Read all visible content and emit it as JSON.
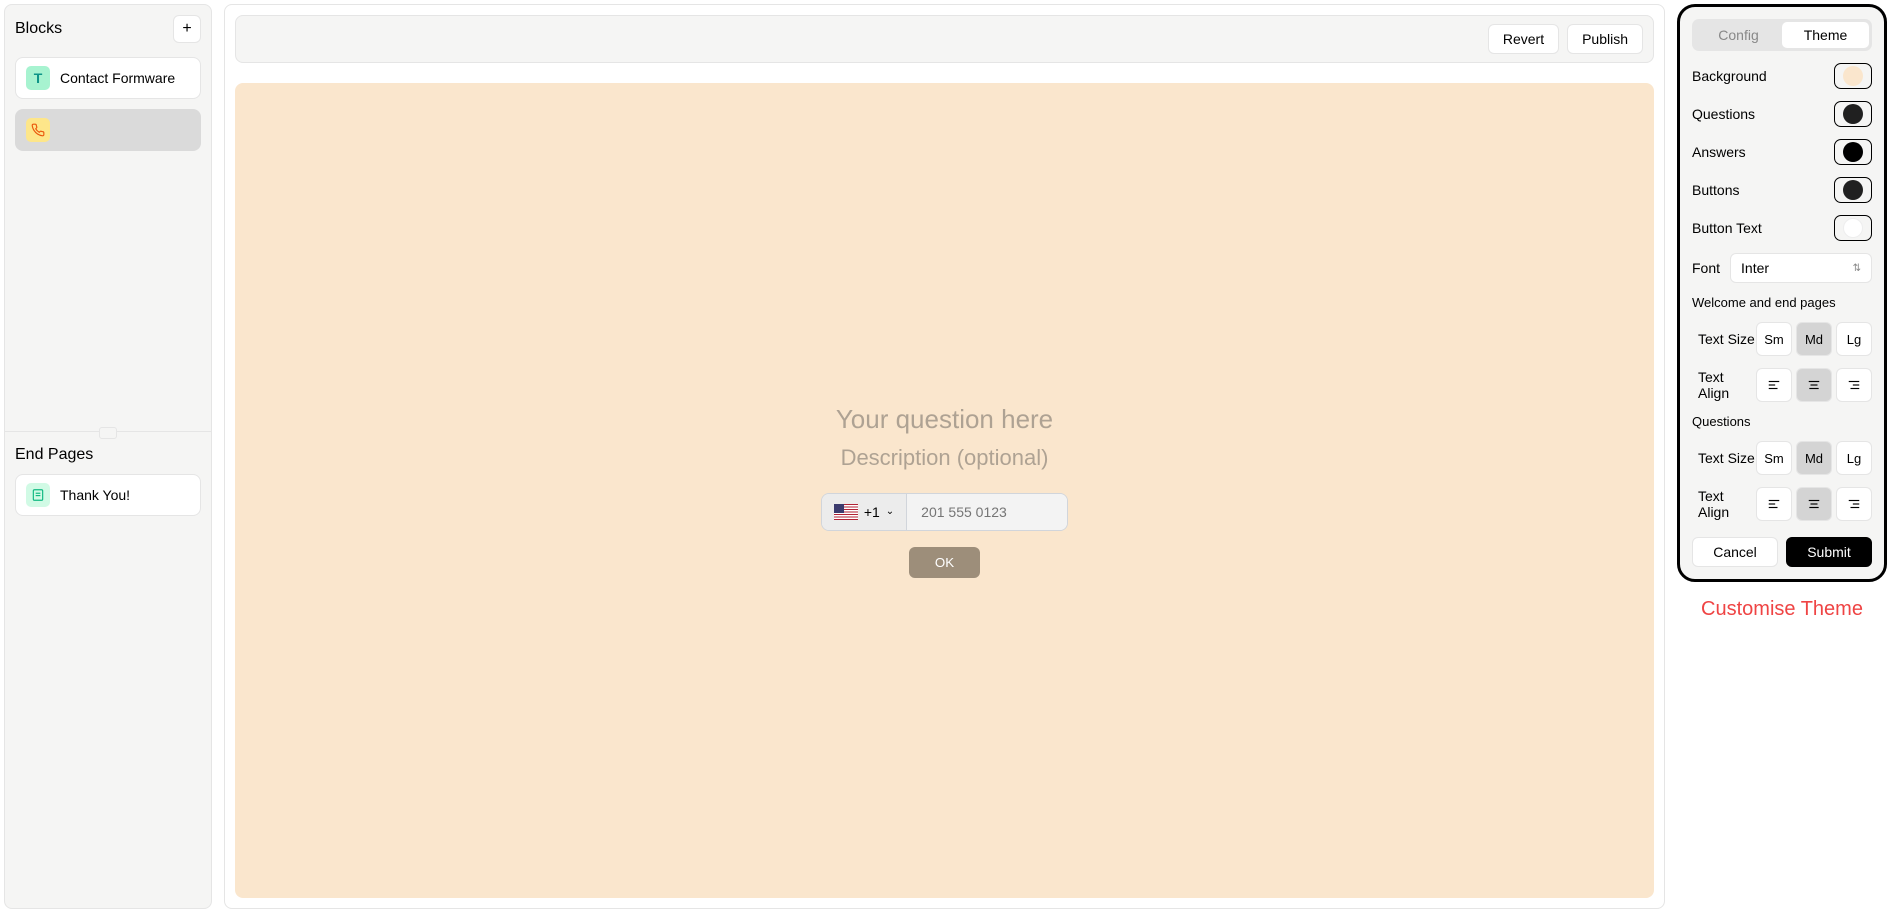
{
  "sidebar": {
    "blocks_title": "Blocks",
    "items": [
      {
        "label": "Contact Formware",
        "icon": "text"
      },
      {
        "label": "",
        "icon": "phone"
      }
    ],
    "end_pages_title": "End Pages",
    "end_items": [
      {
        "label": "Thank You!",
        "icon": "doc"
      }
    ]
  },
  "topbar": {
    "revert": "Revert",
    "publish": "Publish"
  },
  "canvas": {
    "question_placeholder": "Your question here",
    "description_placeholder": "Description (optional)",
    "country_code": "+1",
    "phone_placeholder": "201 555 0123",
    "ok_label": "OK"
  },
  "theme": {
    "tabs": {
      "config": "Config",
      "theme": "Theme"
    },
    "colors": {
      "background": {
        "label": "Background",
        "value": "#fae6cd"
      },
      "questions": {
        "label": "Questions",
        "value": "#202020"
      },
      "answers": {
        "label": "Answers",
        "value": "#000000"
      },
      "buttons": {
        "label": "Buttons",
        "value": "#202020"
      },
      "button_text": {
        "label": "Button Text",
        "value": "#ffffff"
      }
    },
    "font": {
      "label": "Font",
      "value": "Inter"
    },
    "welcome_section": "Welcome and end pages",
    "questions_section": "Questions",
    "text_size_label": "Text Size",
    "text_align_label": "Text Align",
    "sizes": {
      "sm": "Sm",
      "md": "Md",
      "lg": "Lg"
    },
    "cancel": "Cancel",
    "submit": "Submit"
  },
  "callout": "Customise Theme"
}
